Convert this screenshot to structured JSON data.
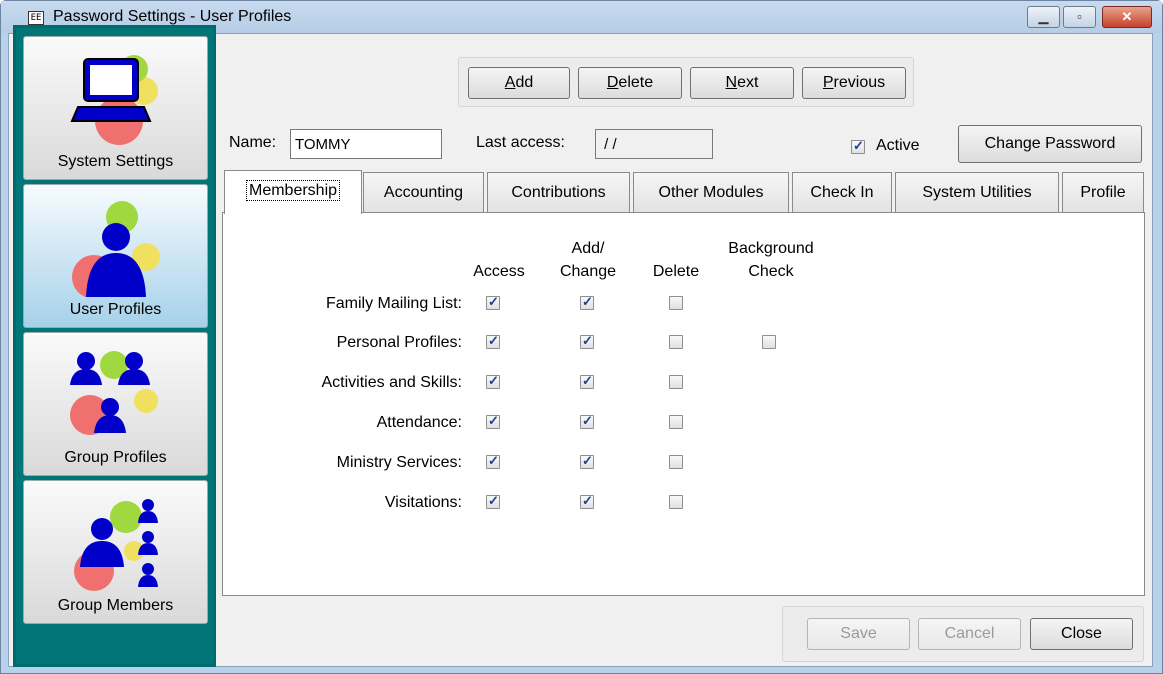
{
  "window": {
    "title": "Password Settings - User Profiles",
    "app_icon_text": "EE"
  },
  "sidebar": {
    "items": [
      {
        "label": "System Settings"
      },
      {
        "label": "User Profiles"
      },
      {
        "label": "Group Profiles"
      },
      {
        "label": "Group Members"
      }
    ]
  },
  "toolbar": {
    "add": "Add",
    "delete": "Delete",
    "next": "Next",
    "previous": "Previous"
  },
  "form": {
    "name_label": "Name:",
    "name_value": "TOMMY",
    "last_access_label": "Last access:",
    "last_access_value": " / /",
    "active_label": "Active",
    "active_checked": true,
    "change_password": "Change Password"
  },
  "tabs": [
    "Membership",
    "Accounting",
    "Contributions",
    "Other Modules",
    "Check In",
    "System Utilities",
    "Profile"
  ],
  "grid": {
    "headers": {
      "access": "Access",
      "add_change_1": "Add/",
      "add_change_2": "Change",
      "delete": "Delete",
      "bg_1": "Background",
      "bg_2": "Check"
    },
    "rows": [
      {
        "label": "Family Mailing List:",
        "access": true,
        "change": true,
        "delete": false
      },
      {
        "label": "Personal Profiles:",
        "access": true,
        "change": true,
        "delete": false,
        "bg": false
      },
      {
        "label": "Activities and Skills:",
        "access": true,
        "change": true,
        "delete": false
      },
      {
        "label": "Attendance:",
        "access": true,
        "change": true,
        "delete": false
      },
      {
        "label": "Ministry Services:",
        "access": true,
        "change": true,
        "delete": false
      },
      {
        "label": "Visitations:",
        "access": true,
        "change": true,
        "delete": false
      }
    ]
  },
  "footer": {
    "save": "Save",
    "cancel": "Cancel",
    "close": "Close"
  },
  "colors": {
    "sidebar_bg": "#017679",
    "figure_blue": "#0000c8",
    "gear_red": "#f07070",
    "gear_green": "#a0d840",
    "gear_yellow": "#f0e060"
  }
}
